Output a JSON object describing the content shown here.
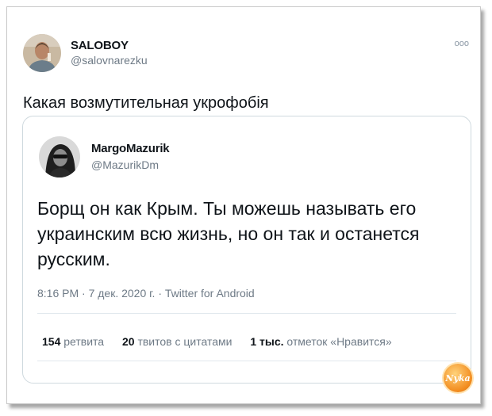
{
  "tweet": {
    "author": {
      "name": "SALOBOY",
      "handle": "@salovnarezku"
    },
    "more_icon": "more-dots-icon",
    "text": "Какая возмутительная укрофобія"
  },
  "quoted_tweet": {
    "author": {
      "name": "MargoMazurik",
      "handle": "@MazurikDm"
    },
    "text": "Борщ он как Крым. Ты можешь называть его украинским всю жизнь, но он так и останется русским.",
    "meta": "8:16 PM · 7 дек. 2020 г. · Twitter for Android",
    "stats": [
      {
        "count": "154",
        "label": "ретвита"
      },
      {
        "count": "20",
        "label": "твитов с цитатами"
      },
      {
        "count": "1 тыс.",
        "label": "отметок «Нравится»"
      }
    ]
  },
  "watermark": {
    "text": "Nyka"
  }
}
